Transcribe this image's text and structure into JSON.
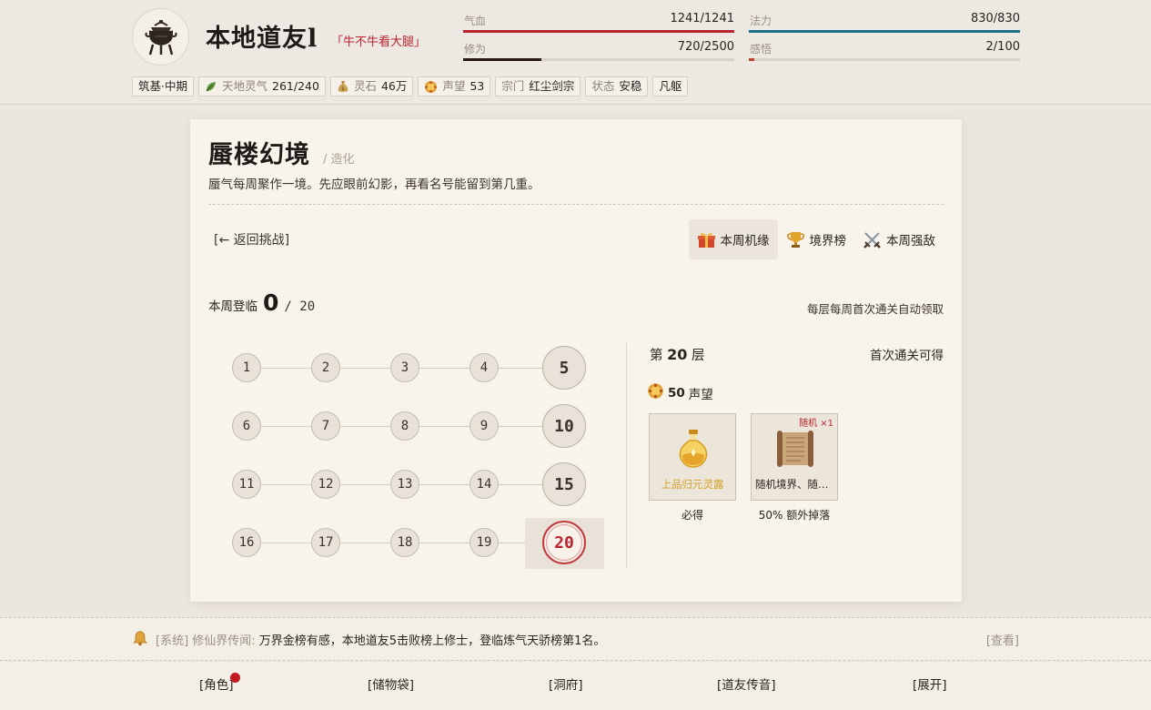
{
  "header": {
    "avatar_icon": "incense-burner-icon",
    "player_name": "本地道友l",
    "player_title": "「牛不牛看大腿」",
    "stats": [
      {
        "label": "气血",
        "value": "1241/1241",
        "fill": 1.0,
        "color": "#b8232f"
      },
      {
        "label": "法力",
        "value": "830/830",
        "fill": 1.0,
        "color": "#1f6f8f"
      },
      {
        "label": "修为",
        "value": "720/2500",
        "fill": 0.288,
        "color": "#2a1a14"
      },
      {
        "label": "感悟",
        "value": "2/100",
        "fill": 0.02,
        "color": "#b8452a"
      }
    ],
    "tags": {
      "realm": "筑基·中期",
      "qi_label": "天地灵气",
      "qi_value": "261/240",
      "qi_icon": "leaf-icon",
      "stone_label": "灵石",
      "stone_value": "46万",
      "stone_icon": "money-bag-icon",
      "fame_label": "声望",
      "fame_value": "53",
      "fame_icon": "gold-medal-icon",
      "sect_label": "宗门",
      "sect_value": "红尘剑宗",
      "state_label": "状态",
      "state_value": "安稳",
      "body": "凡躯"
    }
  },
  "main": {
    "title": "蜃楼幻境",
    "crumb": "/ 造化",
    "desc": "蜃气每周聚作一境。先应眼前幻影，再看名号能留到第几重。",
    "back": "[← 返回挑战]",
    "tabs": [
      {
        "label": "本周机缘",
        "icon": "gift-icon",
        "active": true
      },
      {
        "label": "境界榜",
        "icon": "trophy-icon",
        "active": false
      },
      {
        "label": "本周强敌",
        "icon": "crossed-swords-icon",
        "active": false
      }
    ],
    "weekly_label": "本周登临",
    "weekly_count": "0",
    "weekly_total": "/ 20",
    "auto_note": "每层每周首次通关自动领取",
    "floors": [
      "1",
      "2",
      "3",
      "4",
      "5",
      "6",
      "7",
      "8",
      "9",
      "10",
      "11",
      "12",
      "13",
      "14",
      "15",
      "16",
      "17",
      "18",
      "19",
      "20"
    ],
    "selected_floor": "20"
  },
  "detail": {
    "floor_prefix": "第",
    "floor_num": "20",
    "floor_suffix": "层",
    "first_clear": "首次通关可得",
    "reward_amount": "50",
    "reward_unit": "声望",
    "items": [
      {
        "name": "上品归元灵露",
        "caption": "必得",
        "icon": "elixir-bottle-icon",
        "badge": ""
      },
      {
        "name": "随机境界、随机功法残页",
        "caption": "50% 额外掉落",
        "icon": "scroll-icon",
        "badge": "随机 ×1"
      }
    ]
  },
  "news": {
    "source": "[系统] 修仙界传闻:",
    "message": "万界金榜有感，本地道友5击败榜上修士，登临炼气天骄榜第1名。",
    "view": "[查看]"
  },
  "nav": [
    "[角色]",
    "[储物袋]",
    "[洞府]",
    "[道友传音]",
    "[展开]"
  ],
  "colors": {
    "accent_red": "#b8232f",
    "mana_blue": "#1f6f8f",
    "gold": "#d4a22a"
  }
}
